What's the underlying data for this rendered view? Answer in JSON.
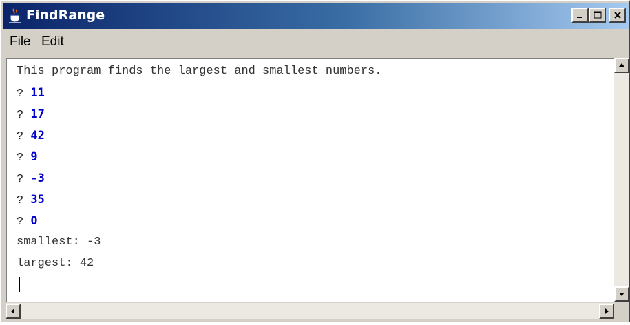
{
  "window": {
    "title": "FindRange",
    "title_icon": "java-cup-icon",
    "controls": {
      "minimize": "minimize-icon",
      "maximize": "maximize-icon",
      "close": "close-icon"
    }
  },
  "menu": {
    "items": [
      {
        "label": "File"
      },
      {
        "label": "Edit"
      }
    ]
  },
  "console": {
    "intro": "This program finds the largest and smallest numbers.",
    "prompt": "?",
    "inputs": [
      "11",
      "17",
      "42",
      "9",
      "-3",
      "35",
      "0"
    ],
    "smallest_line": "smallest: -3",
    "largest_line": "largest: 42"
  },
  "colors": {
    "titlebar_start": "#0a246a",
    "titlebar_end": "#a6caf0",
    "input_text": "#0000cc",
    "window_face": "#d4d0c8"
  }
}
